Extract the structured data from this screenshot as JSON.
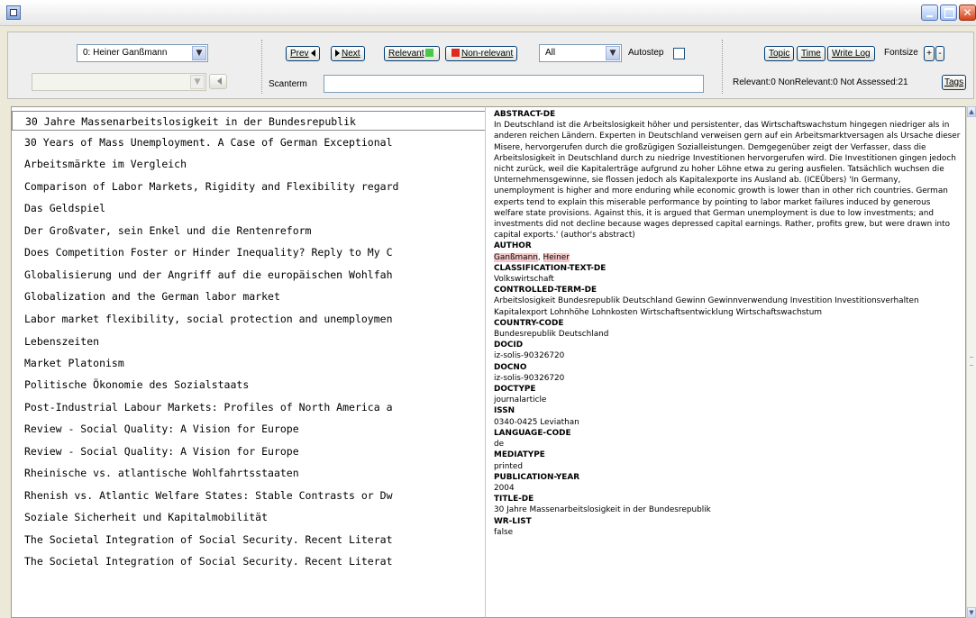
{
  "window": {
    "controls": {
      "minimize_icon": "minimize-icon",
      "maximize_icon": "maximize-icon",
      "close_icon": "close-icon"
    }
  },
  "toolbar": {
    "user_select": "0: Heiner Ganßmann",
    "prev_label": "Prev",
    "next_label": "Next",
    "relevant_label": "Relevant",
    "nonrelevant_label": "Non-relevant",
    "filter_select": "All",
    "autostep_label": "Autostep",
    "autostep_checked": false,
    "topic_label": "Topic",
    "time_label": "Time",
    "writelog_label": "Write Log",
    "fontsize_label": "Fontsize",
    "fontsize_plus": "+",
    "fontsize_minus": "-",
    "scanterm_label": "Scanterm",
    "scanterm_value": "",
    "status_text": "Relevant:0 NonRelevant:0 Not Assessed:21",
    "tags_label": "Tags",
    "colors": {
      "relevant": "#46c946",
      "nonrelevant": "#e02a20"
    }
  },
  "documents": [
    "30 Jahre Massenarbeitslosigkeit in der Bundesrepublik",
    "30 Years of Mass Unemployment. A Case of German Exceptional",
    "Arbeitsmärkte im Vergleich",
    "Comparison of Labor Markets, Rigidity and Flexibility regard",
    "Das Geldspiel",
    "Der Großvater, sein Enkel und die Rentenreform",
    "Does Competition Foster or Hinder Inequality? Reply to My C",
    "Globalisierung und der Angriff auf die europäischen Wohlfah",
    "Globalization and the German labor market",
    "Labor market flexibility, social protection and unemploymen",
    "Lebenszeiten",
    "Market Platonism",
    "Politische Ökonomie des Sozialstaats",
    "Post-Industrial Labour Markets: Profiles of North America a",
    "Review - Social Quality: A Vision for Europe",
    "Review - Social Quality: A Vision for Europe",
    "Rheinische vs. atlantische Wohlfahrtsstaaten",
    "Rhenish vs. Atlantic Welfare States: Stable Contrasts or Dw",
    "Soziale Sicherheit und Kapitalmobilität",
    "The Societal Integration of Social Security. Recent Literat",
    "The Societal Integration of Social Security. Recent Literat"
  ],
  "detail": {
    "abstract_label": "ABSTRACT-DE",
    "abstract_text": "In Deutschland ist die Arbeitslosigkeit höher und persistenter, das Wirtschaftswachstum hingegen niedriger als in anderen reichen Ländern. Experten in Deutschland verweisen gern auf ein Arbeitsmarktversagen als Ursache dieser Misere, hervorgerufen durch die großzügigen Sozialleistungen. Demgegenüber zeigt der Verfasser, dass die Arbeitslosigkeit in Deutschland durch zu niedrige Investitionen hervorgerufen wird. Die Investitionen gingen jedoch nicht zurück, weil die Kapitalerträge aufgrund zu hoher Löhne etwa zu gering ausfielen. Tatsächlich wuchsen die Unternehmensgewinne, sie flossen jedoch als Kapitalexporte ins Ausland ab. (ICEÜbers) 'In Germany, unemployment is higher and more enduring while economic growth is lower than in other rich countries. German experts tend to explain this miserable performance by pointing to labor market failures induced by generous welfare state provisions. Against this, it is argued that German unemployment is due to low investments; and investments did not decline because wages depressed capital earnings. Rather, profits grew, but were drawn into capital exports.' (author's abstract)",
    "author_label": "AUTHOR",
    "author_last": "Ganßmann",
    "author_sep": ", ",
    "author_first": "Heiner",
    "classification_label": "CLASSIFICATION-TEXT-DE",
    "classification_text": "Volkswirtschaft",
    "controlled_label": "CONTROLLED-TERM-DE",
    "controlled_text": "Arbeitslosigkeit Bundesrepublik Deutschland Gewinn Gewinnverwendung Investition Investitionsverhalten Kapitalexport Lohnhöhe Lohnkosten Wirtschaftsentwicklung Wirtschaftswachstum",
    "country_label": "COUNTRY-CODE",
    "country_text": "Bundesrepublik Deutschland",
    "docid_label": "DOCID",
    "docid_text": "iz-solis-90326720",
    "docno_label": "DOCNO",
    "docno_text": "iz-solis-90326720",
    "doctype_label": "DOCTYPE",
    "doctype_text": "journalarticle",
    "issn_label": "ISSN",
    "issn_text": "0340-0425 Leviathan",
    "language_label": "LANGUAGE-CODE",
    "language_text": "de",
    "mediatype_label": "MEDIATYPE",
    "mediatype_text": "printed",
    "pubyear_label": "PUBLICATION-YEAR",
    "pubyear_text": "2004",
    "title_label": "TITLE-DE",
    "title_text": "30 Jahre Massenarbeitslosigkeit in der Bundesrepublik",
    "wrlist_label": "WR-LIST",
    "wrlist_text": "false"
  }
}
